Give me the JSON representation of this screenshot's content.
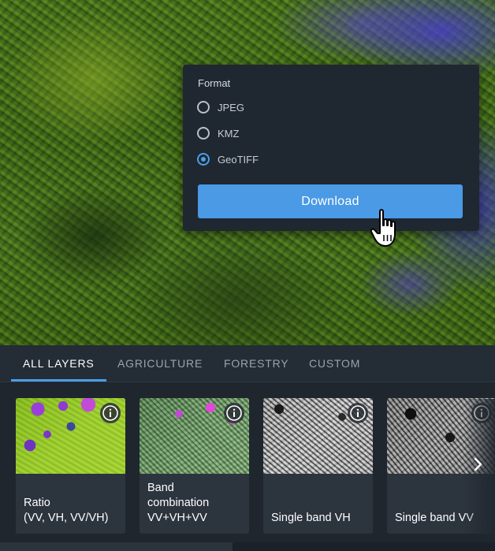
{
  "download_popover": {
    "format_label": "Format",
    "options": [
      {
        "label": "JPEG",
        "selected": false
      },
      {
        "label": "KMZ",
        "selected": false
      },
      {
        "label": "GeoTIFF",
        "selected": true
      }
    ],
    "download_label": "Download"
  },
  "tabs": [
    {
      "label": "ALL LAYERS",
      "active": true
    },
    {
      "label": "AGRICULTURE",
      "active": false
    },
    {
      "label": "FORESTRY",
      "active": false
    },
    {
      "label": "CUSTOM",
      "active": false
    }
  ],
  "layers": [
    {
      "title": "Ratio\n(VV, VH, VV/VH)"
    },
    {
      "title": "Band\ncombination\nVV+VH+VV"
    },
    {
      "title": "Single band VH"
    },
    {
      "title": "Single band VV"
    }
  ],
  "colors": {
    "accent": "#4c9ee8",
    "button": "#4a9ae6",
    "panel": "#1f262e",
    "card": "#2c343e"
  }
}
